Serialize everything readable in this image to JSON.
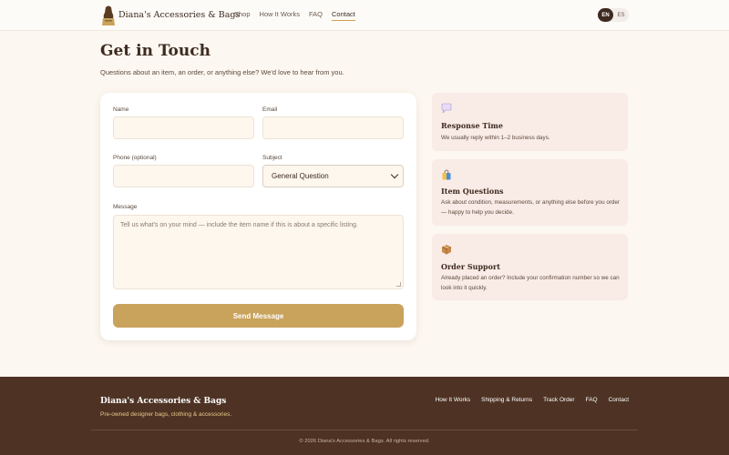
{
  "header": {
    "brand": "Diana's Accessories & Bags",
    "nav": [
      "Shop",
      "How It Works",
      "FAQ",
      "Contact"
    ],
    "lang_en": "EN",
    "lang_es": "ES"
  },
  "page": {
    "title": "Get in Touch",
    "subtitle": "Questions about an item, an order, or anything else? We'd love to hear from you."
  },
  "form": {
    "name_label": "Name",
    "name_value": "",
    "email_label": "Email",
    "email_value": "",
    "phone_label": "Phone (optional)",
    "phone_value": "",
    "subject_label": "Subject",
    "subject_value": "General Question",
    "message_label": "Message",
    "message_placeholder": "Tell us what's on your mind — include the item name if this is about a specific listing.",
    "send_label": "Send Message"
  },
  "info": [
    {
      "icon": "speech-bubble-icon",
      "title": "Response Time",
      "text": "We usually reply within 1–2 business days."
    },
    {
      "icon": "shopping-bag-icon",
      "title": "Item Questions",
      "text": "Ask about condition, measurements, or anything else before you order — happy to help you decide."
    },
    {
      "icon": "package-icon",
      "title": "Order Support",
      "text": "Already placed an order? Include your confirmation number so we can look into it quickly."
    }
  ],
  "footer": {
    "brand": "Diana's Accessories & Bags",
    "tagline": "Pre-owned designer bags, clothing & accessories.",
    "links": [
      "How It Works",
      "Shipping & Returns",
      "Track Order",
      "FAQ",
      "Contact"
    ],
    "copyright": "© 2026 Diana's Accessories & Bags. All rights reserved."
  },
  "colors": {
    "accent": "#c9a25c",
    "brand_dark": "#4e3324",
    "background": "#fcf7f0",
    "info_card": "#f9ebe6"
  }
}
